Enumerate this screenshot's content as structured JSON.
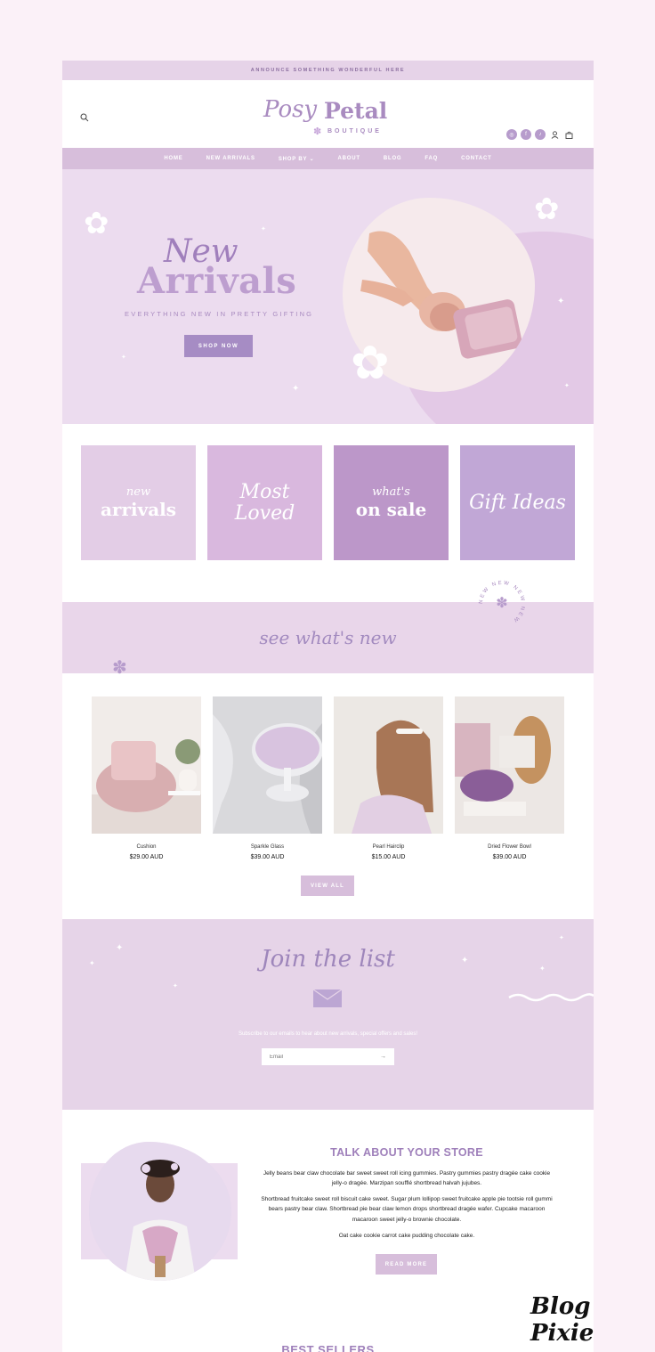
{
  "announcement": "ANNOUNCE SOMETHING WONDERFUL HERE",
  "logo": {
    "script": "Posy",
    "bold": "Petal",
    "sub": "BOUTIQUE"
  },
  "nav": [
    "HOME",
    "NEW ARRIVALS",
    "SHOP BY ⌄",
    "ABOUT",
    "BLOG",
    "FAQ",
    "CONTACT"
  ],
  "hero": {
    "title_script": "New",
    "title_bold": "Arrivals",
    "subtitle": "EVERYTHING NEW IN PRETTY GIFTING",
    "button": "SHOP NOW"
  },
  "tiles": [
    {
      "script": "new",
      "bold": "arrivals",
      "color": "#e3cde6"
    },
    {
      "script": "Most Loved",
      "bold": "",
      "color": "#d9b8de"
    },
    {
      "script": "what's",
      "bold": "on sale",
      "color": "#bc97c9"
    },
    {
      "script": "Gift Ideas",
      "bold": "",
      "color": "#c1a7d6"
    }
  ],
  "banner": {
    "text": "see what's new",
    "badge": "NEW NEW NEW NEW"
  },
  "products": [
    {
      "name": "Cushion",
      "price": "$29.00 AUD"
    },
    {
      "name": "Sparkle Glass",
      "price": "$39.00 AUD"
    },
    {
      "name": "Pearl Hairclip",
      "price": "$15.00 AUD"
    },
    {
      "name": "Dried Flower Bowl",
      "price": "$39.00 AUD"
    }
  ],
  "view_all": "VIEW ALL",
  "join": {
    "title": "Join the list",
    "subtitle": "Subscribe to our emails to hear about new arrivals, special offers and sales!",
    "email_placeholder": "Email",
    "submit": "→"
  },
  "about": {
    "title": "TALK ABOUT YOUR STORE",
    "p1": "Jelly beans bear claw chocolate bar sweet sweet roll icing gummies. Pastry gummies pastry dragée cake cookie jelly-o dragée. Marzipan soufflé shortbread halvah jujubes.",
    "p2": "Shortbread fruitcake sweet roll biscuit cake sweet. Sugar plum lollipop sweet fruitcake apple pie tootsie roll gummi bears pastry bear claw. Shortbread pie bear claw lemon drops shortbread dragée wafer. Cupcake macaroon macaroon sweet jelly-o brownie chocolate.",
    "p3": "Oat cake cookie carrot cake pudding chocolate cake.",
    "button": "READ MORE"
  },
  "best_sellers": "BEST SELLERS",
  "signature": "Blog Pixie",
  "colors": {
    "accent": "#a98bc0",
    "nav": "#d7bedb",
    "hero_bg": "#ecdcef",
    "button": "#a68cc4"
  },
  "icons": [
    "search-icon",
    "instagram-icon",
    "facebook-icon",
    "tiktok-icon",
    "account-icon",
    "cart-icon"
  ]
}
